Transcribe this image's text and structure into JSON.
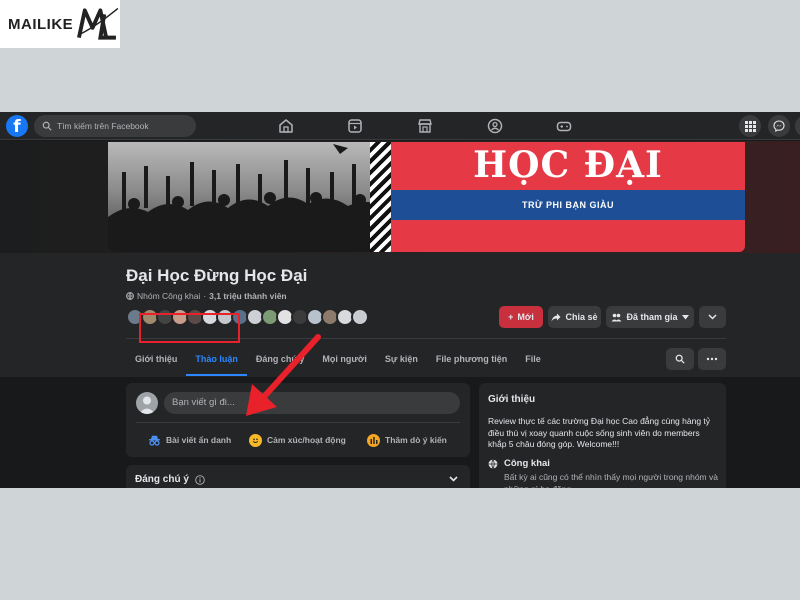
{
  "watermark": {
    "brand": "MAILIKE"
  },
  "topbar": {
    "logo": "f",
    "search_placeholder": "Tìm kiếm trên Facebook",
    "nav_icons": [
      "home-icon",
      "video-icon",
      "marketplace-icon",
      "groups-icon",
      "gaming-icon"
    ],
    "right_icons": [
      "menu-grid-icon",
      "messenger-icon"
    ]
  },
  "cover": {
    "title": "HỌC ĐẠI",
    "subtitle": "TRỪ PHI BẠN GIÀU",
    "colors": {
      "red": "#e63946",
      "blue": "#1d4e96"
    }
  },
  "group": {
    "name": "Đại Học Đừng Học Đại",
    "privacy": "Nhóm Công khai",
    "members": "3,1 triệu thành viên",
    "member_avatar_count": 16
  },
  "actions": {
    "new_label": "Mới",
    "share_label": "Chia sẻ",
    "joined_label": "Đã tham gia"
  },
  "tabs": [
    {
      "label": "Giới thiệu",
      "active": false
    },
    {
      "label": "Thảo luận",
      "active": true
    },
    {
      "label": "Đáng chú ý",
      "active": false
    },
    {
      "label": "Mọi người",
      "active": false
    },
    {
      "label": "Sự kiện",
      "active": false
    },
    {
      "label": "File phương tiện",
      "active": false
    },
    {
      "label": "File",
      "active": false
    }
  ],
  "composer": {
    "placeholder": "Bạn viết gì đi...",
    "anonymous_label": "Bài viết ẩn danh",
    "feeling_label": "Cảm xúc/hoạt động",
    "poll_label": "Thăm dò ý kiến"
  },
  "featured": {
    "title": "Đáng chú ý"
  },
  "about": {
    "title": "Giới thiệu",
    "description": "Review thực tế các trường Đại học Cao đẳng cùng hàng tỷ điều thú vị xoay quanh cuộc sống sinh viên do members khắp 5 châu đóng góp. Welcome!!!",
    "public_title": "Công khai",
    "public_desc": "Bất kỳ ai cũng có thể nhìn thấy mọi người trong nhóm và những gì họ đăng."
  },
  "colors": {
    "accent": "#2d88ff",
    "highlight": "#e8212b",
    "fb_blue": "#1877f2"
  }
}
